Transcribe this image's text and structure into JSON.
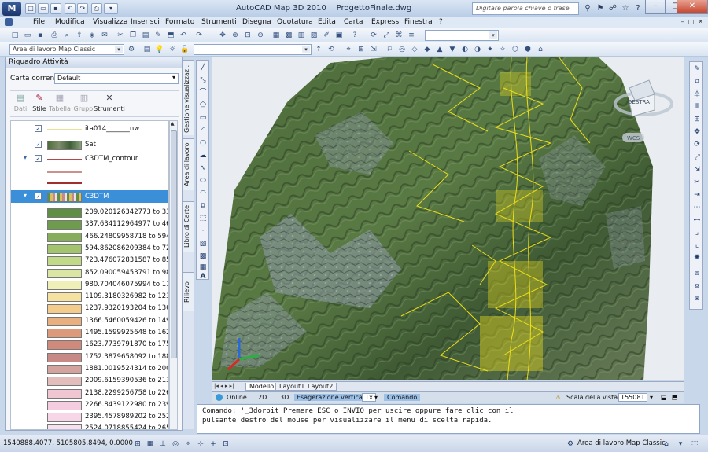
{
  "app": {
    "logo": "M",
    "title": "AutoCAD Map 3D 2010",
    "file": "ProgettoFinale.dwg",
    "search_placeholder": "Digitare parola chiave o frase"
  },
  "menu": [
    "File",
    "Modifica",
    "Visualizza",
    "Inserisci",
    "Formato",
    "Strumenti",
    "Disegna",
    "Quotatura",
    "Edita",
    "Carta",
    "Express",
    "Finestra",
    "?"
  ],
  "toolbar": {
    "workspace": "Area di lavoro Map Classic"
  },
  "task_pane": {
    "title": "Riquadro Attività",
    "map_label": "Carta corrente:",
    "map_value": "Default",
    "tools": [
      {
        "label": "Dati",
        "enabled": false
      },
      {
        "label": "Stile",
        "enabled": true
      },
      {
        "label": "Tabella",
        "enabled": false
      },
      {
        "label": "Gruppi",
        "enabled": false
      },
      {
        "label": "Strumenti",
        "enabled": true
      }
    ],
    "layers": [
      {
        "name": "ita014_______nw"
      },
      {
        "name": "Sat"
      },
      {
        "name": "C3DTM_contour"
      },
      {
        "name": "C3DTM"
      }
    ],
    "legend": [
      {
        "range": "209.020126342773 to 337.63411...",
        "color": "#5f8f45"
      },
      {
        "range": "337.634112964977 to 466.24809...",
        "color": "#6e9c4c"
      },
      {
        "range": "466.24809958718 to 594.862086...",
        "color": "#86ad5a"
      },
      {
        "range": "594.862086209384 to 723.47607...",
        "color": "#a3c46c"
      },
      {
        "range": "723.476072831587 to 852.09005...",
        "color": "#c2d98a"
      },
      {
        "range": "852.090059453791 to 980.70404...",
        "color": "#dbe6a4"
      },
      {
        "range": "980.704046075994 to 1109.3180...",
        "color": "#efefb8"
      },
      {
        "range": "1109.3180326982 to 1237.9320...",
        "color": "#f6e2a0"
      },
      {
        "range": "1237.9320193204 to 1366.5460...",
        "color": "#f3cb8c"
      },
      {
        "range": "1366.5460059426 to 1495.1599...",
        "color": "#e8b07e"
      },
      {
        "range": "1495.1599925648 to 1623.7739...",
        "color": "#dc9a7a"
      },
      {
        "range": "1623.7739791870 to 1752.3879...",
        "color": "#cf8a7c"
      },
      {
        "range": "1752.3879658092 to 1881.0019...",
        "color": "#c88a86"
      },
      {
        "range": "1881.0019524314 to 2009.6159...",
        "color": "#d3a3a0"
      },
      {
        "range": "2009.6159390536 to 2138.2299...",
        "color": "#e3bcbc"
      },
      {
        "range": "2138.2299256758 to 2266.8439...",
        "color": "#f0c6d2"
      },
      {
        "range": "2266.8439122980 to 2395.4578...",
        "color": "#f5cde0"
      },
      {
        "range": "2395.4578989202 to 2524.0718...",
        "color": "#f7d6e8"
      },
      {
        "range": "2524.0718855424 to 2652.6858...",
        "color": "#f9e0ef"
      }
    ],
    "side_tabs": [
      "Gestione visualizzaz...",
      "Area di lavoro",
      "Libro di Carte",
      "Rilievo"
    ]
  },
  "viewcube": {
    "face": "DESTRA",
    "wcs": "WCS"
  },
  "layout_tabs": [
    "Modello",
    "Layout1",
    "Layout2"
  ],
  "status_mid": {
    "online": "Online",
    "d2": "2D",
    "d3": "3D",
    "exag": "Esagerazione verticale:",
    "exag_val": "1x",
    "comando": "Comando",
    "scala": "Scala della vista 1:",
    "scala_val": "155081"
  },
  "command": {
    "line1": "Comando: '_3dorbit Premere ESC o INVIO per uscire oppure fare clic con il",
    "line2": "pulsante destro del mouse per visualizzare il menu di scelta rapida."
  },
  "statusbar": {
    "coords": "1540888.4077, 5105805.8494, 0.0000",
    "workspace": "Area di lavoro Map Classic"
  }
}
